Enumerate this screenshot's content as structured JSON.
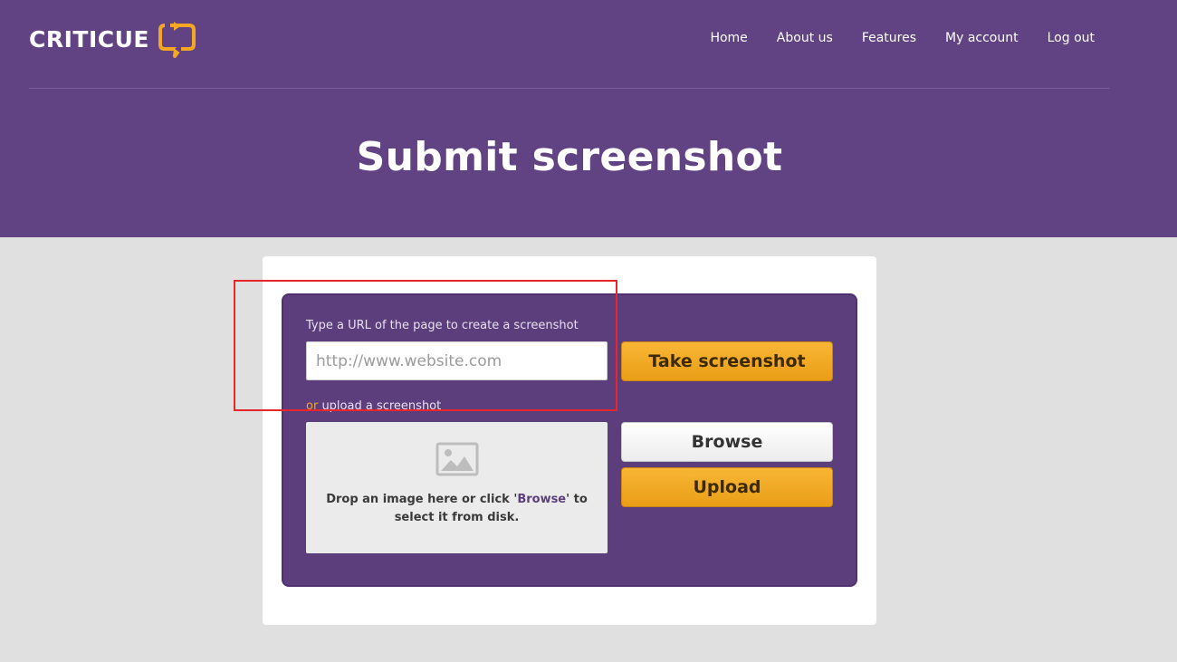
{
  "brand": {
    "name": "CRITICUE",
    "accent": "#f5a623",
    "header_color": "#614384"
  },
  "nav": {
    "items": [
      "Home",
      "About us",
      "Features",
      "My account",
      "Log out"
    ]
  },
  "page": {
    "title": "Submit screenshot"
  },
  "form": {
    "url_label": "Type a URL of the page to create a screenshot",
    "url_placeholder": "http://www.website.com",
    "url_value": "",
    "take_button": "Take screenshot",
    "upload_or": "or",
    "upload_label": " upload a screenshot",
    "drop_text_before": "Drop an image here or click '",
    "drop_text_link": "Browse",
    "drop_text_after": "' to select it from disk.",
    "browse_button": "Browse",
    "upload_button": "Upload"
  },
  "icons": {
    "logo": "speech-bubble-arrows-icon",
    "dropzone": "image-placeholder-icon"
  }
}
